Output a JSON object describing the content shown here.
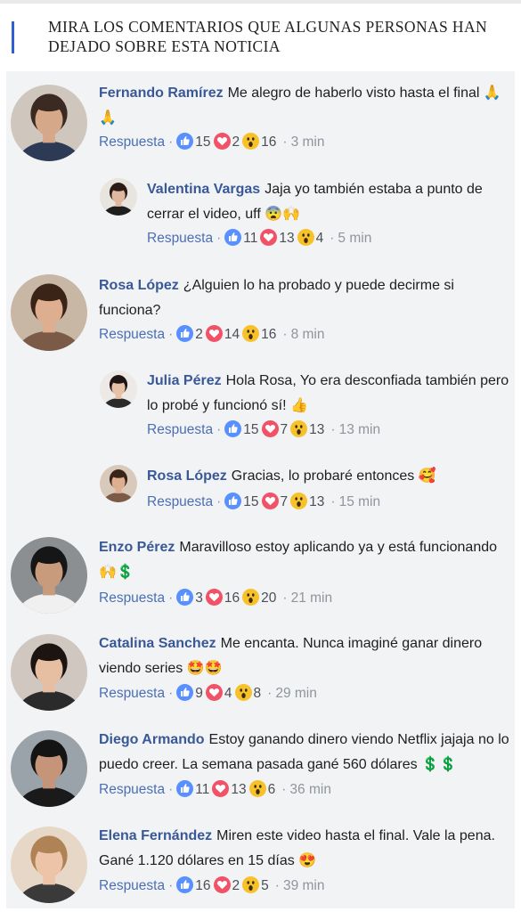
{
  "header": {
    "title": "MIRA LOS COMENTARIOS QUE ALGUNAS PERSONAS HAN DEJADO SOBRE ESTA NOTICIA"
  },
  "colors": {
    "accent_bar": "#2f5fd0",
    "name_link": "#385898",
    "panel_bg": "#f2f3f5",
    "like": "#5890ff",
    "love": "#f25268",
    "wow": "#f7c229"
  },
  "reply_label": "Respuesta",
  "comments": [
    {
      "name": "Fernando Ramírez",
      "text": "Me alegro de haberlo visto hasta el final 🙏 🙏",
      "likes": "15",
      "loves": "2",
      "wows": "16",
      "time": "3 min",
      "avatar_icon": "man-avatar-icon"
    },
    {
      "name": "Valentina Vargas",
      "text": "Jaja yo también estaba a punto de cerrar el video, uff 😨🙌",
      "likes": "11",
      "loves": "13",
      "wows": "4",
      "time": "5 min",
      "avatar_icon": "woman-avatar-icon"
    },
    {
      "name": "Rosa López",
      "text": "¿Alguien lo ha probado y puede decirme si funciona?",
      "likes": "2",
      "loves": "14",
      "wows": "16",
      "time": "8 min",
      "avatar_icon": "woman-avatar-icon"
    },
    {
      "name": "Julia Pérez",
      "text": "Hola Rosa, Yo era desconfiada también pero lo probé y funcionó sí! 👍",
      "likes": "15",
      "loves": "7",
      "wows": "13",
      "time": "13 min",
      "avatar_icon": "woman-avatar-icon"
    },
    {
      "name": "Rosa López",
      "text": "Gracias, lo probaré entonces 🥰",
      "likes": "15",
      "loves": "7",
      "wows": "13",
      "time": "15 min",
      "avatar_icon": "woman-avatar-icon"
    },
    {
      "name": "Enzo Pérez",
      "text": "Maravilloso estoy aplicando ya y está funcionando 🙌💲",
      "likes": "3",
      "loves": "16",
      "wows": "20",
      "time": "21 min",
      "avatar_icon": "man-avatar-icon"
    },
    {
      "name": "Catalina Sanchez",
      "text": "Me encanta. Nunca imaginé ganar dinero viendo series 🤩🤩",
      "likes": "9",
      "loves": "4",
      "wows": "8",
      "time": "29 min",
      "avatar_icon": "woman-avatar-icon"
    },
    {
      "name": "Diego Armando",
      "text": "Estoy ganando dinero viendo Netflix jajaja no lo puedo creer. La semana pasada gané 560 dólares 💲💲",
      "likes": "11",
      "loves": "13",
      "wows": "6",
      "time": "36 min",
      "avatar_icon": "man-avatar-icon"
    },
    {
      "name": "Elena Fernández",
      "text": "Miren este video hasta el final. Vale la pena. Gané 1.120 dólares en 15 días 😍",
      "likes": "16",
      "loves": "2",
      "wows": "5",
      "time": "39 min",
      "avatar_icon": "woman-avatar-icon"
    }
  ]
}
